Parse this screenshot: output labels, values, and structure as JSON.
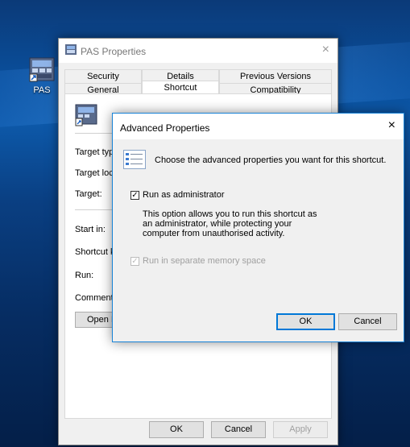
{
  "desktop": {
    "icon_label": "PAS"
  },
  "props_window": {
    "title": "PAS Properties",
    "tabs_top": [
      "Security",
      "Details",
      "Previous Versions"
    ],
    "tabs_bottom": [
      "General",
      "Shortcut",
      "Compatibility"
    ],
    "active_tab": "Shortcut",
    "fields": [
      "Target type",
      "Target loca",
      "Target:",
      "Start in:",
      "Shortcut ke",
      "Run:",
      "Comment:"
    ],
    "open_file_button": "Open F",
    "buttons": {
      "ok": "OK",
      "cancel": "Cancel",
      "apply": "Apply"
    }
  },
  "advanced_dialog": {
    "title": "Advanced Properties",
    "description": "Choose the advanced properties you want for this shortcut.",
    "run_as_admin": {
      "label": "Run as administrator",
      "checked": true
    },
    "note": "This option allows you to run this shortcut as an administrator, while protecting your computer from unauthorised activity.",
    "separate_memory": {
      "label": "Run in separate memory space",
      "checked": true,
      "disabled": true
    },
    "buttons": {
      "ok": "OK",
      "cancel": "Cancel"
    }
  },
  "colors": {
    "accent": "#0078d7",
    "dialog_border": "#1883d7",
    "window_bg": "#f0f0f0"
  },
  "icons": {
    "close": "×",
    "check": "✓"
  }
}
